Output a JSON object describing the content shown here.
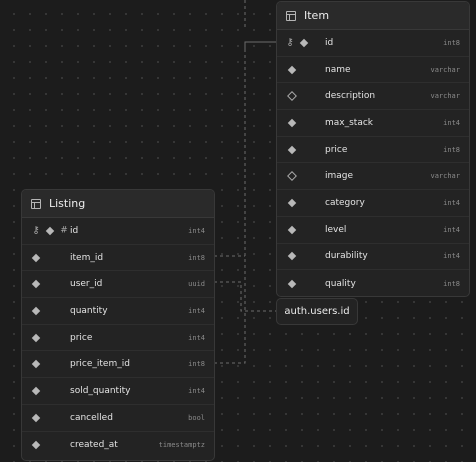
{
  "tables": {
    "item": {
      "title": "Item",
      "columns": [
        {
          "name": "id",
          "type": "int8",
          "primary_key": true,
          "nullable": false,
          "icon": "key-icon"
        },
        {
          "name": "name",
          "type": "varchar",
          "nullable": false
        },
        {
          "name": "description",
          "type": "varchar",
          "nullable": true
        },
        {
          "name": "max_stack",
          "type": "int4",
          "nullable": false
        },
        {
          "name": "price",
          "type": "int8",
          "nullable": false
        },
        {
          "name": "image",
          "type": "varchar",
          "nullable": true
        },
        {
          "name": "category",
          "type": "int4",
          "nullable": false
        },
        {
          "name": "level",
          "type": "int4",
          "nullable": false
        },
        {
          "name": "durability",
          "type": "int4",
          "nullable": false
        },
        {
          "name": "quality",
          "type": "int8",
          "nullable": false
        }
      ]
    },
    "listing": {
      "title": "Listing",
      "columns": [
        {
          "name": "id",
          "type": "int4",
          "primary_key": true,
          "identity": true,
          "nullable": false,
          "icon": "key-icon"
        },
        {
          "name": "item_id",
          "type": "int8",
          "nullable": false
        },
        {
          "name": "user_id",
          "type": "uuid",
          "nullable": false
        },
        {
          "name": "quantity",
          "type": "int4",
          "nullable": false
        },
        {
          "name": "price",
          "type": "int4",
          "nullable": false
        },
        {
          "name": "price_item_id",
          "type": "int8",
          "nullable": false
        },
        {
          "name": "sold_quantity",
          "type": "int4",
          "nullable": false
        },
        {
          "name": "cancelled",
          "type": "bool",
          "nullable": false
        },
        {
          "name": "created_at",
          "type": "timestamptz",
          "nullable": false
        }
      ]
    }
  },
  "external_tables": {
    "auth_users_id": "auth.users.id"
  },
  "relations": [
    {
      "from": "Listing.item_id",
      "to": "Item.id"
    },
    {
      "from": "Listing.user_id",
      "to": "auth.users.id"
    },
    {
      "from": "Listing.price_item_id",
      "to": "Item.id"
    }
  ],
  "colors": {
    "canvas": "#1c1c1c",
    "card": "#232323",
    "card_header": "#2a2a2a",
    "border": "#383838",
    "connector": "#6b6b6b",
    "text": "#ededed",
    "type_text": "#8a8a8a"
  }
}
